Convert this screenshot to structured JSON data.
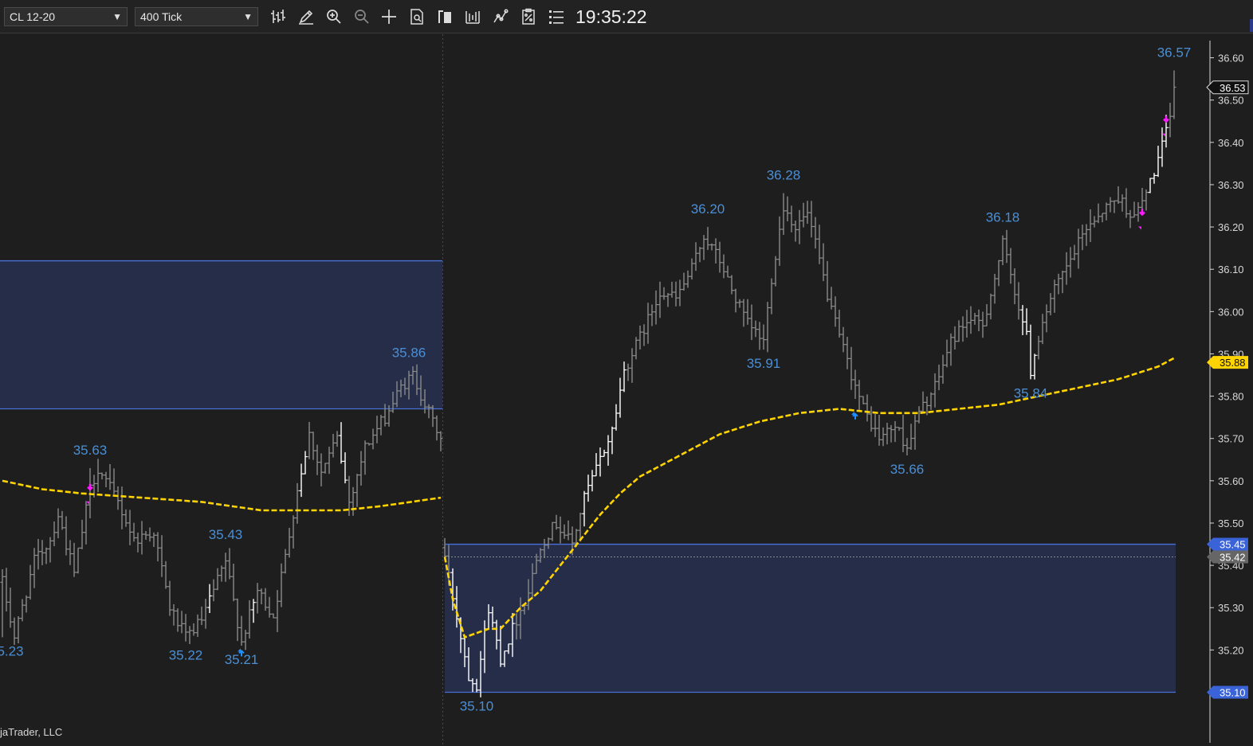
{
  "toolbar": {
    "instrument": "CL 12-20",
    "interval": "400 Tick",
    "clock": "19:35:22",
    "icons": [
      "bar-type-icon",
      "draw-pencil-icon",
      "zoom-in-icon",
      "zoom-out-icon",
      "crosshair-icon",
      "data-box-icon",
      "chart-trader-icon",
      "strategies-icon",
      "indicators-icon",
      "templates-icon",
      "properties-icon"
    ]
  },
  "copyright": "jaTrader, LLC",
  "colors": {
    "background": "#1e1e1e",
    "bars": "#8a8a8a",
    "bars_highlight": "#ffffff",
    "ma_line": "#ffd400",
    "zone_fill": "#262d48",
    "zone_border": "#4a6fd6",
    "swing_label": "#4a8fd6",
    "buy_arrow": "#1e90ff",
    "sell_arrow": "#ff1aff"
  },
  "chart_data": {
    "type": "ohlc",
    "ylim": [
      35.02,
      36.65
    ],
    "y_ticks": [
      "36.60",
      "36.50",
      "36.40",
      "36.30",
      "36.20",
      "36.10",
      "36.00",
      "35.90",
      "35.80",
      "35.70",
      "35.60",
      "35.50",
      "35.40",
      "35.30",
      "35.20"
    ],
    "price_badges": [
      {
        "label": "36.53",
        "value": 36.53,
        "kind": "last"
      },
      {
        "label": "35.88",
        "value": 35.88,
        "kind": "ma"
      },
      {
        "label": "35.45",
        "value": 35.45,
        "kind": "zone"
      },
      {
        "label": "35.42",
        "value": 35.42,
        "kind": "ref"
      },
      {
        "label": "35.10",
        "value": 35.1,
        "kind": "zone"
      }
    ],
    "swing_labels": [
      {
        "label": "5.23",
        "bar": 0,
        "value": 35.23,
        "pos": "low"
      },
      {
        "label": "35.63",
        "bar": 22,
        "value": 35.63,
        "pos": "high"
      },
      {
        "label": "35.22",
        "bar": 46,
        "value": 35.22,
        "pos": "low"
      },
      {
        "label": "35.43",
        "bar": 56,
        "value": 35.43,
        "pos": "high"
      },
      {
        "label": "35.21",
        "bar": 60,
        "value": 35.21,
        "pos": "low"
      },
      {
        "label": "35.86",
        "bar": 102,
        "value": 35.86,
        "pos": "high"
      },
      {
        "label": "35.10",
        "bar": 119,
        "value": 35.1,
        "pos": "low"
      },
      {
        "label": "36.20",
        "bar": 177,
        "value": 36.2,
        "pos": "high"
      },
      {
        "label": "35.91",
        "bar": 191,
        "value": 35.91,
        "pos": "low"
      },
      {
        "label": "36.28",
        "bar": 196,
        "value": 36.28,
        "pos": "high"
      },
      {
        "label": "35.66",
        "bar": 227,
        "value": 35.66,
        "pos": "low"
      },
      {
        "label": "36.18",
        "bar": 251,
        "value": 36.18,
        "pos": "high"
      },
      {
        "label": "35.84",
        "bar": 258,
        "value": 35.84,
        "pos": "low"
      },
      {
        "label": "36.57",
        "bar": 294,
        "value": 36.57,
        "pos": "high"
      }
    ],
    "zones": [
      {
        "from_bar": 0,
        "to_bar": 110,
        "top": 36.12,
        "bottom": 35.77
      },
      {
        "from_bar": 111,
        "to_bar": 294,
        "top": 35.45,
        "bottom": 35.1
      }
    ],
    "ref_line": {
      "value": 35.42,
      "from_bar": 111,
      "to_bar": 294
    },
    "session_break_bar": 110.5,
    "signals": [
      {
        "bar": 22,
        "type": "sell",
        "value": 35.57
      },
      {
        "bar": 60,
        "type": "buy",
        "value": 35.2
      },
      {
        "bar": 214,
        "type": "buy",
        "value": 35.76
      },
      {
        "bar": 286,
        "type": "sell",
        "value": 36.22
      },
      {
        "bar": 292,
        "type": "sell",
        "value": 36.44
      }
    ],
    "ohlc_anchors": [
      [
        0,
        35.36
      ],
      [
        3,
        35.23
      ],
      [
        8,
        35.41
      ],
      [
        12,
        35.46
      ],
      [
        14,
        35.52
      ],
      [
        18,
        35.38
      ],
      [
        22,
        35.58
      ],
      [
        24,
        35.63
      ],
      [
        29,
        35.55
      ],
      [
        33,
        35.46
      ],
      [
        38,
        35.48
      ],
      [
        42,
        35.3
      ],
      [
        46,
        35.23
      ],
      [
        50,
        35.27
      ],
      [
        56,
        35.41
      ],
      [
        60,
        35.22
      ],
      [
        64,
        35.34
      ],
      [
        68,
        35.28
      ],
      [
        71,
        35.42
      ],
      [
        74,
        35.58
      ],
      [
        77,
        35.71
      ],
      [
        80,
        35.62
      ],
      [
        84,
        35.7
      ],
      [
        87,
        35.55
      ],
      [
        91,
        35.68
      ],
      [
        96,
        35.75
      ],
      [
        100,
        35.82
      ],
      [
        103,
        35.85
      ],
      [
        107,
        35.76
      ],
      [
        110,
        35.7
      ],
      [
        111,
        35.42
      ],
      [
        114,
        35.28
      ],
      [
        117,
        35.14
      ],
      [
        119,
        35.12
      ],
      [
        122,
        35.3
      ],
      [
        125,
        35.18
      ],
      [
        128,
        35.25
      ],
      [
        132,
        35.34
      ],
      [
        135,
        35.45
      ],
      [
        139,
        35.5
      ],
      [
        143,
        35.45
      ],
      [
        146,
        35.56
      ],
      [
        150,
        35.65
      ],
      [
        153,
        35.72
      ],
      [
        156,
        35.86
      ],
      [
        159,
        35.92
      ],
      [
        162,
        35.98
      ],
      [
        165,
        36.05
      ],
      [
        169,
        36.03
      ],
      [
        173,
        36.1
      ],
      [
        176,
        36.18
      ],
      [
        180,
        36.12
      ],
      [
        183,
        36.05
      ],
      [
        187,
        35.97
      ],
      [
        191,
        35.93
      ],
      [
        193,
        36.08
      ],
      [
        196,
        36.25
      ],
      [
        199,
        36.2
      ],
      [
        202,
        36.23
      ],
      [
        205,
        36.12
      ],
      [
        208,
        36.0
      ],
      [
        212,
        35.88
      ],
      [
        216,
        35.77
      ],
      [
        220,
        35.7
      ],
      [
        224,
        35.73
      ],
      [
        227,
        35.68
      ],
      [
        230,
        35.76
      ],
      [
        234,
        35.82
      ],
      [
        238,
        35.93
      ],
      [
        242,
        35.98
      ],
      [
        246,
        35.97
      ],
      [
        249,
        36.08
      ],
      [
        251,
        36.16
      ],
      [
        254,
        36.05
      ],
      [
        257,
        35.94
      ],
      [
        258,
        35.86
      ],
      [
        261,
        35.98
      ],
      [
        264,
        36.05
      ],
      [
        268,
        36.12
      ],
      [
        272,
        36.2
      ],
      [
        276,
        36.24
      ],
      [
        280,
        36.27
      ],
      [
        284,
        36.22
      ],
      [
        287,
        36.28
      ],
      [
        290,
        36.36
      ],
      [
        292,
        36.42
      ],
      [
        294,
        36.52
      ]
    ],
    "ma_anchors": [
      [
        0,
        35.6
      ],
      [
        10,
        35.58
      ],
      [
        20,
        35.57
      ],
      [
        35,
        35.56
      ],
      [
        50,
        35.55
      ],
      [
        65,
        35.53
      ],
      [
        75,
        35.53
      ],
      [
        85,
        35.53
      ],
      [
        95,
        35.54
      ],
      [
        110,
        35.56
      ],
      [
        111,
        35.42
      ],
      [
        113,
        35.32
      ],
      [
        116,
        35.23
      ],
      [
        119,
        35.24
      ],
      [
        122,
        35.25
      ],
      [
        125,
        35.25
      ],
      [
        130,
        35.3
      ],
      [
        135,
        35.34
      ],
      [
        140,
        35.4
      ],
      [
        145,
        35.46
      ],
      [
        150,
        35.52
      ],
      [
        155,
        35.57
      ],
      [
        160,
        35.61
      ],
      [
        166,
        35.64
      ],
      [
        172,
        35.67
      ],
      [
        180,
        35.71
      ],
      [
        190,
        35.74
      ],
      [
        200,
        35.76
      ],
      [
        210,
        35.77
      ],
      [
        220,
        35.76
      ],
      [
        230,
        35.76
      ],
      [
        240,
        35.77
      ],
      [
        250,
        35.78
      ],
      [
        260,
        35.8
      ],
      [
        270,
        35.82
      ],
      [
        280,
        35.84
      ],
      [
        290,
        35.87
      ],
      [
        294,
        35.89
      ]
    ]
  }
}
